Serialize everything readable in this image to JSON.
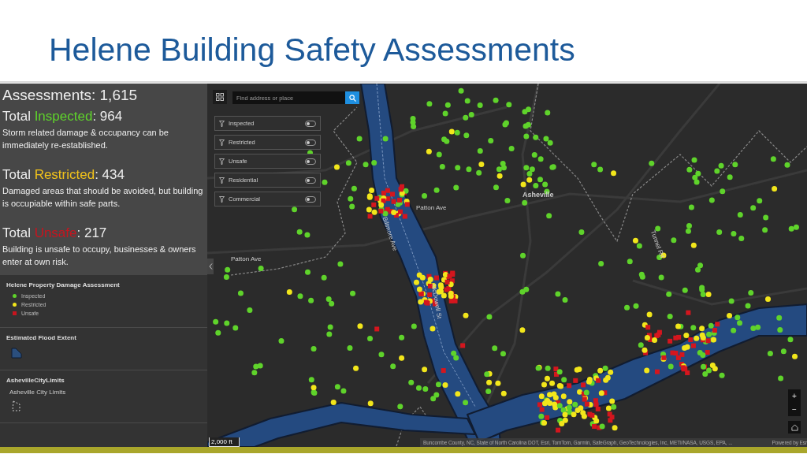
{
  "slide": {
    "title": "Helene Building Safety Assessments"
  },
  "summary": {
    "title": "Assessments: 1,615",
    "items": [
      {
        "prefix": "Total ",
        "status": "Inspected",
        "count": ": 964",
        "color": "#5fd32b",
        "description": "Storm related damage & occupancy can be immediately re-established."
      },
      {
        "prefix": "Total ",
        "status": "Restricted",
        "count": ": 434",
        "color": "#f2c31b",
        "description": "Damaged areas that should be avoided, but building is occupiable within safe parts."
      },
      {
        "prefix": "Total ",
        "status": "Unsafe",
        "count": ": 217",
        "color": "#c8141e",
        "description": "Building is unsafe to occupy, businesses & owners enter at own risk."
      }
    ]
  },
  "legend": [
    {
      "kind": "points",
      "title": "Helene Property Damage Assessment",
      "entries": [
        {
          "label": "Inspected",
          "color": "#5fd32b",
          "kind": "circle"
        },
        {
          "label": "Restricted",
          "color": "#f2e61b",
          "kind": "circle"
        },
        {
          "label": "Unsafe",
          "color": "#c8141e",
          "kind": "square"
        }
      ]
    },
    {
      "kind": "polygon",
      "title": "Estimated Flood Extent"
    },
    {
      "kind": "outline",
      "title": "AshevilleCityLimits",
      "subtitle": "Asheville City Limits"
    }
  ],
  "search": {
    "placeholder": "Find address or place"
  },
  "filters": [
    {
      "label": "Inspected",
      "on": false
    },
    {
      "label": "Restricted",
      "on": false
    },
    {
      "label": "Unsafe",
      "on": false
    },
    {
      "label": "Residential",
      "on": false
    },
    {
      "label": "Commercial",
      "on": false
    }
  ],
  "map_labels": [
    {
      "text": "Asheville",
      "kind": "city"
    },
    {
      "text": "Patton Ave",
      "kind": "road"
    },
    {
      "text": "Patton Ave",
      "kind": "road"
    },
    {
      "text": "Biltmore Ave",
      "kind": "road"
    },
    {
      "text": "McDowell St",
      "kind": "road"
    },
    {
      "text": "Tunnel Rd",
      "kind": "road"
    }
  ],
  "zoom": {
    "in": "+",
    "out": "−"
  },
  "scale": "2,000 ft",
  "attribution": "Buncombe County, NC, State of North Carolina DOT, Esri, TomTom, Garmin, SafeGraph, GeoTechnologies, Inc, METI/NASA, USGS, EPA, ...",
  "powered_by": "Powered by Esr"
}
